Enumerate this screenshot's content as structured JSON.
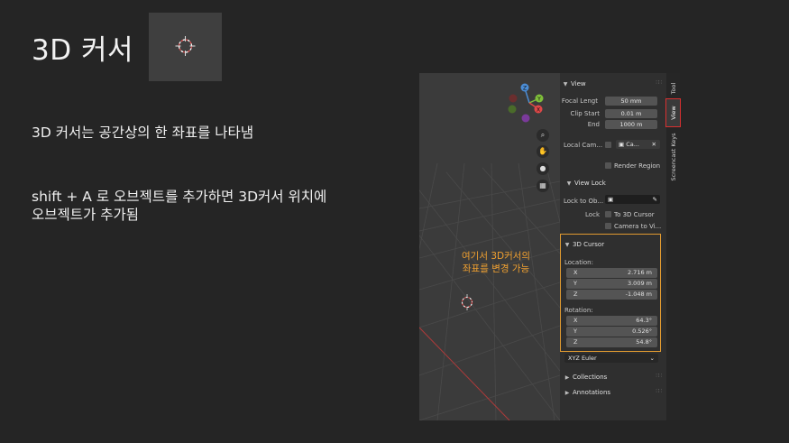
{
  "slide": {
    "title": "3D 커서",
    "line1": "3D 커서는 공간상의 한 좌표를 나타냄",
    "line2": "shift + A 로 오브젝트를 추가하면 3D커서 위치에",
    "line3": "오브젝트가 추가됨"
  },
  "annotation": {
    "line1": "여기서 3D커서의",
    "line2": "좌표를 변경 가능",
    "color": "#f0a030"
  },
  "gizmo": {
    "z": "Z",
    "y": "Y",
    "x": "X"
  },
  "panel": {
    "view_header": "View",
    "focal_label": "Focal Lengt",
    "focal_value": "50 mm",
    "clip_start_label": "Clip Start",
    "clip_start_value": "0.01 m",
    "end_label": "End",
    "end_value": "1000 m",
    "local_cam_label": "Local Cam...",
    "local_cam_value": "Ca...",
    "render_region": "Render Region",
    "view_lock_header": "View Lock",
    "lock_obj_label": "Lock to Ob...",
    "lock_label": "Lock",
    "to_cursor": "To 3D Cursor",
    "camera_to_view": "Camera to Vi...",
    "cursor_header": "3D Cursor",
    "location_label": "Location:",
    "location": [
      {
        "axis": "X",
        "value": "2.716 m"
      },
      {
        "axis": "Y",
        "value": "3.009 m"
      },
      {
        "axis": "Z",
        "value": "-1.048 m"
      }
    ],
    "rotation_label": "Rotation:",
    "rotation": [
      {
        "axis": "X",
        "value": "64.3°"
      },
      {
        "axis": "Y",
        "value": "0.526°"
      },
      {
        "axis": "Z",
        "value": "54.8°"
      }
    ],
    "rotation_mode": "XYZ Euler",
    "collections": "Collections",
    "annotations": "Annotations"
  },
  "tabs": {
    "tool": "Tool",
    "view": "View",
    "screencast": "Screencast Keys"
  },
  "icons": {
    "zoom": "zoom-icon",
    "hand": "hand-icon",
    "camera": "camera-icon",
    "grid": "grid-icon",
    "eyedropper": "eyedropper-icon"
  }
}
